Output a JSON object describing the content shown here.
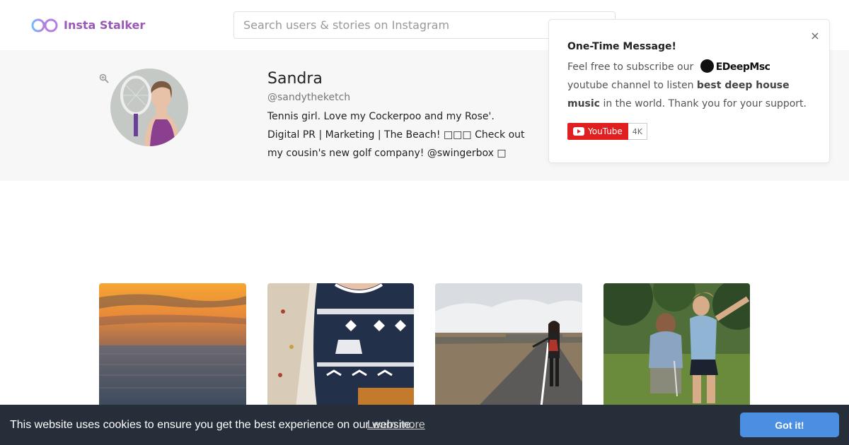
{
  "header": {
    "logo_text": "Insta Stalker",
    "search_placeholder": "Search users & stories on Instagram"
  },
  "profile": {
    "name": "Sandra",
    "handle": "@sandytheketch",
    "bio": "Tennis girl. Love my Cockerpoo and my Rose'. Digital PR | Marketing | The Beach! □□□ Check out my cousin's new golf company! @swingerbox □"
  },
  "popup": {
    "title": "One-Time Message!",
    "text_before": "Feel free to subscribe our",
    "brand_name": "EDeepMsc",
    "text_mid": "youtube channel to listen",
    "bold_text": "best deep house music",
    "text_after": "in the world. Thank you for your support.",
    "youtube_label": "YouTube",
    "youtube_count": "4K",
    "close_label": "×"
  },
  "cookie": {
    "message": "This website uses cookies to ensure you get the best experience on our website.",
    "learn_more": "Learn more",
    "button": "Got it!"
  },
  "posts": [
    {
      "subject": "sunset-over-sea"
    },
    {
      "subject": "reindeer-sweater"
    },
    {
      "subject": "woman-on-road"
    },
    {
      "subject": "golf-lesson"
    }
  ],
  "colors": {
    "brand": "#9b59b6",
    "cookie_bg": "#252e39",
    "cookie_button": "#4a8fe2",
    "youtube_red": "#e02020",
    "profile_band": "#f7f7f7"
  }
}
